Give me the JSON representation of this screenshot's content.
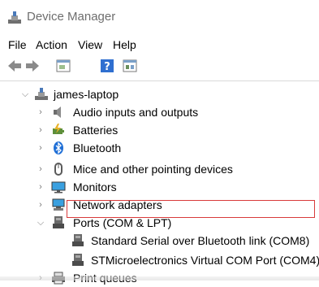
{
  "window": {
    "title": "Device Manager",
    "icon": "device-manager-icon"
  },
  "menu": [
    "File",
    "Action",
    "View",
    "Help"
  ],
  "toolbar": [
    {
      "name": "back-icon"
    },
    {
      "name": "forward-icon"
    },
    {
      "name": "properties-icon"
    },
    {
      "name": "help-icon"
    },
    {
      "name": "view-icon"
    }
  ],
  "tree": {
    "root": "james-laptop",
    "items": [
      {
        "label": "Audio inputs and outputs",
        "icon": "speaker-icon",
        "expanded": false
      },
      {
        "label": "Batteries",
        "icon": "battery-icon",
        "expanded": false
      },
      {
        "label": "Bluetooth",
        "icon": "bluetooth-icon",
        "expanded": false
      },
      {
        "label": "Mice and other pointing devices",
        "icon": "mouse-icon",
        "expanded": false
      },
      {
        "label": "Monitors",
        "icon": "monitor-icon",
        "expanded": false
      },
      {
        "label": "Network adapters",
        "icon": "network-icon",
        "expanded": false
      },
      {
        "label": "Ports (COM & LPT)",
        "icon": "port-icon",
        "expanded": true,
        "children": [
          {
            "label": "Standard Serial over Bluetooth link (COM8)",
            "icon": "port-icon"
          },
          {
            "label": "STMicroelectronics Virtual COM Port (COM4)",
            "icon": "port-icon",
            "highlighted": true
          }
        ]
      },
      {
        "label": "Print queues",
        "icon": "printer-icon",
        "expanded": false
      }
    ]
  },
  "colors": {
    "highlight_border": "#d83b3b",
    "title_text": "#6e6e6e"
  }
}
